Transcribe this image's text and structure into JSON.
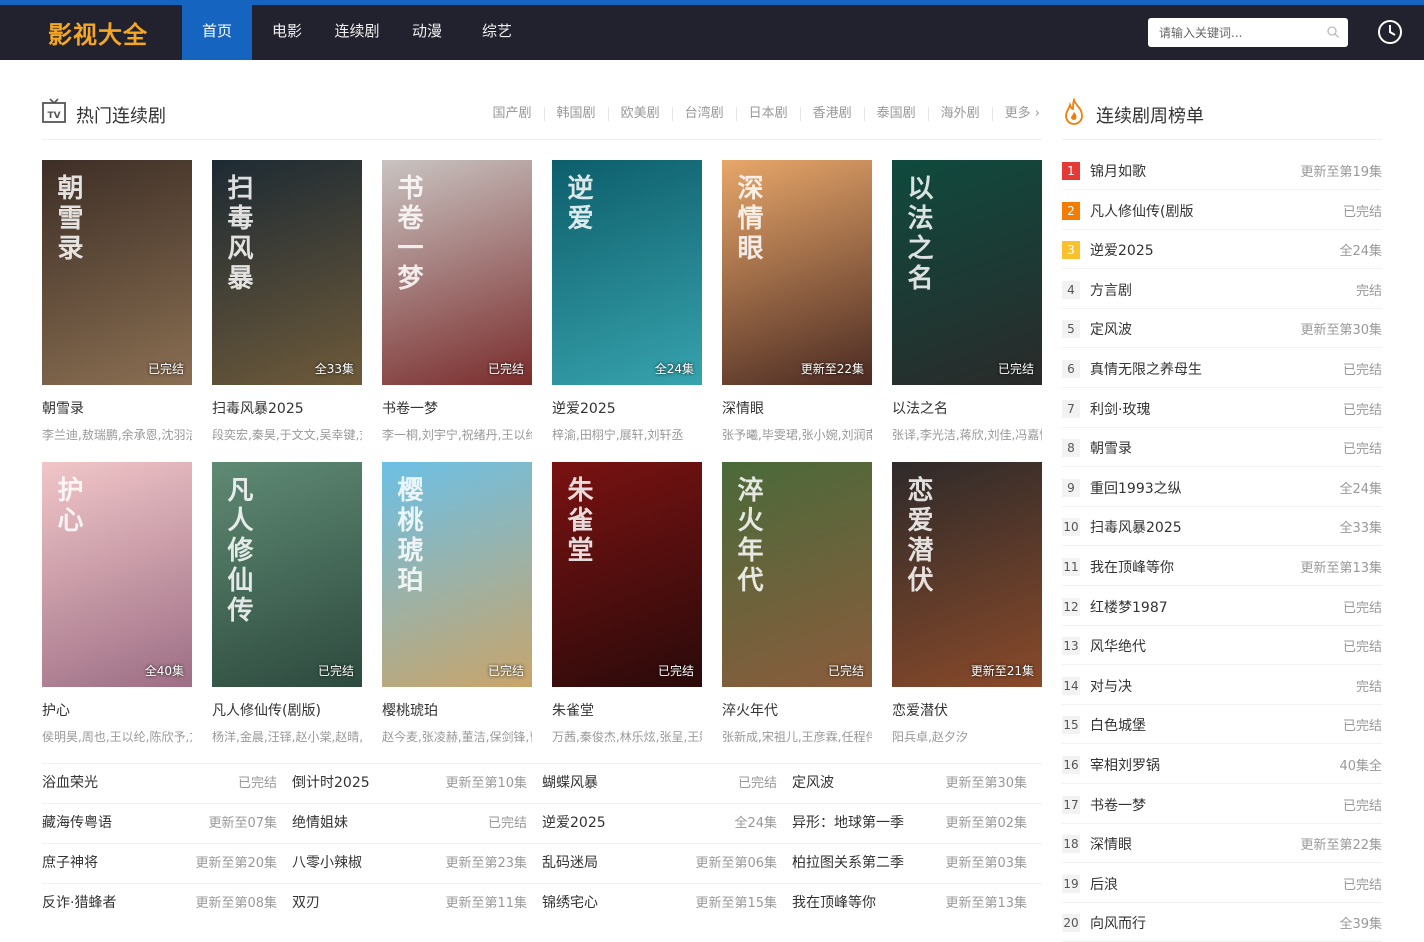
{
  "site": {
    "logo": "影视大全"
  },
  "nav": [
    "首页",
    "电影",
    "连续剧",
    "动漫",
    "综艺"
  ],
  "search": {
    "placeholder": "请输入关键词..."
  },
  "section": {
    "title": "热门连续剧",
    "categories": [
      "国产剧",
      "韩国剧",
      "欧美剧",
      "台湾剧",
      "日本剧",
      "香港剧",
      "泰国剧",
      "海外剧",
      "更多 ›"
    ]
  },
  "cards": [
    {
      "name": "朝雪录",
      "actors": "李兰迪,敖瑞鹏,余承恩,沈羽洁",
      "badge": "已完结",
      "poster_text": "朝雪录",
      "c1": "#3d2e26",
      "c2": "#8a6f52"
    },
    {
      "name": "扫毒风暴2025",
      "actors": "段奕宏,秦昊,于文文,吴幸键,刘",
      "badge": "全33集",
      "poster_text": "扫毒风暴",
      "c1": "#1d2a33",
      "c2": "#6e5a3a"
    },
    {
      "name": "书卷一梦",
      "actors": "李一桐,刘宇宁,祝绪丹,王以纶",
      "badge": "已完结",
      "poster_text": "书卷一梦",
      "c1": "#c9c4c2",
      "c2": "#7a2c2c"
    },
    {
      "name": "逆爱2025",
      "actors": "梓渝,田栩宁,展轩,刘轩丞",
      "badge": "全24集",
      "poster_text": "逆爱",
      "c1": "#0d5e6b",
      "c2": "#37a3ad"
    },
    {
      "name": "深情眼",
      "actors": "张予曦,毕雯珺,张小婉,刘润南",
      "badge": "更新至22集",
      "poster_text": "深情眼",
      "c1": "#e8a76a",
      "c2": "#4a2a22"
    },
    {
      "name": "以法之名",
      "actors": "张译,李光洁,蒋欣,刘佳,冯嘉怡",
      "badge": "已完结",
      "poster_text": "以法之名",
      "c1": "#0f4a3e",
      "c2": "#2a2a2a"
    },
    {
      "name": "护心",
      "actors": "侯明昊,周也,王以纶,陈欣予,方",
      "badge": "全40集",
      "poster_text": "护心",
      "c1": "#f1c6c8",
      "c2": "#9d6e85"
    },
    {
      "name": "凡人修仙传(剧版)",
      "actors": "杨洋,金晨,汪铎,赵小棠,赵晴,",
      "badge": "已完结",
      "poster_text": "凡人修仙传",
      "c1": "#5f8a74",
      "c2": "#2d4a3e"
    },
    {
      "name": "樱桃琥珀",
      "actors": "赵今麦,张凌赫,董洁,保剑锋,曹",
      "badge": "已完结",
      "poster_text": "樱桃琥珀",
      "c1": "#6cc0e6",
      "c2": "#c9a46a"
    },
    {
      "name": "朱雀堂",
      "actors": "万茜,秦俊杰,林乐炫,张呈,王籁",
      "badge": "已完结",
      "poster_text": "朱雀堂",
      "c1": "#7a1212",
      "c2": "#2a0a0a"
    },
    {
      "name": "淬火年代",
      "actors": "张新成,宋祖儿,王彦霖,任程伟",
      "badge": "已完结",
      "poster_text": "淬火年代",
      "c1": "#4a6a3a",
      "c2": "#8b5c3c"
    },
    {
      "name": "恋爱潜伏",
      "actors": "阳兵卓,赵夕汐",
      "badge": "更新至21集",
      "poster_text": "恋爱潜伏",
      "c1": "#2e2a2a",
      "c2": "#8a4a2a"
    }
  ],
  "list": [
    [
      {
        "t": "浴血荣光",
        "s": "已完结"
      },
      {
        "t": "倒计时2025",
        "s": "更新至第10集"
      },
      {
        "t": "蝴蝶风暴",
        "s": "已完结"
      },
      {
        "t": "定风波",
        "s": "更新至第30集"
      }
    ],
    [
      {
        "t": "藏海传粤语",
        "s": "更新至07集"
      },
      {
        "t": "绝情姐妹",
        "s": "已完结"
      },
      {
        "t": "逆爱2025",
        "s": "全24集"
      },
      {
        "t": "异形：地球第一季",
        "s": "更新至第02集"
      }
    ],
    [
      {
        "t": "庶子神将",
        "s": "更新至第20集"
      },
      {
        "t": "八零小辣椒",
        "s": "更新至第23集"
      },
      {
        "t": "乱码迷局",
        "s": "更新至第06集"
      },
      {
        "t": "柏拉图关系第二季",
        "s": "更新至第03集"
      }
    ],
    [
      {
        "t": "反诈·猎蜂者",
        "s": "更新至第08集"
      },
      {
        "t": "双刃",
        "s": "更新至第11集"
      },
      {
        "t": "锦绣宅心",
        "s": "更新至第15集"
      },
      {
        "t": "我在顶峰等你",
        "s": "更新至第13集"
      }
    ]
  ],
  "sidebar": {
    "title": "连续剧周榜单",
    "items": [
      {
        "n": "1",
        "t": "锦月如歌",
        "s": "更新至第19集"
      },
      {
        "n": "2",
        "t": "凡人修仙传(剧版",
        "s": "已完结"
      },
      {
        "n": "3",
        "t": "逆爱2025",
        "s": "全24集"
      },
      {
        "n": "4",
        "t": "方言剧",
        "s": "完结"
      },
      {
        "n": "5",
        "t": "定风波",
        "s": "更新至第30集"
      },
      {
        "n": "6",
        "t": "真情无限之养母生",
        "s": "已完结"
      },
      {
        "n": "7",
        "t": "利剑·玫瑰",
        "s": "已完结"
      },
      {
        "n": "8",
        "t": "朝雪录",
        "s": "已完结"
      },
      {
        "n": "9",
        "t": "重回1993之纵",
        "s": "全24集"
      },
      {
        "n": "10",
        "t": "扫毒风暴2025",
        "s": "全33集"
      },
      {
        "n": "11",
        "t": "我在顶峰等你",
        "s": "更新至第13集"
      },
      {
        "n": "12",
        "t": "红楼梦1987",
        "s": "已完结"
      },
      {
        "n": "13",
        "t": "风华绝代",
        "s": "已完结"
      },
      {
        "n": "14",
        "t": "对与决",
        "s": "完结"
      },
      {
        "n": "15",
        "t": "白色城堡",
        "s": "已完结"
      },
      {
        "n": "16",
        "t": "宰相刘罗锅",
        "s": "40集全"
      },
      {
        "n": "17",
        "t": "书卷一梦",
        "s": "已完结"
      },
      {
        "n": "18",
        "t": "深情眼",
        "s": "更新至第22集"
      },
      {
        "n": "19",
        "t": "后浪",
        "s": "已完结"
      },
      {
        "n": "20",
        "t": "向风而行",
        "s": "全39集"
      }
    ],
    "rank_colors": {
      "1": "#e53935",
      "2": "#f57c00",
      "3": "#fbc02d"
    }
  }
}
